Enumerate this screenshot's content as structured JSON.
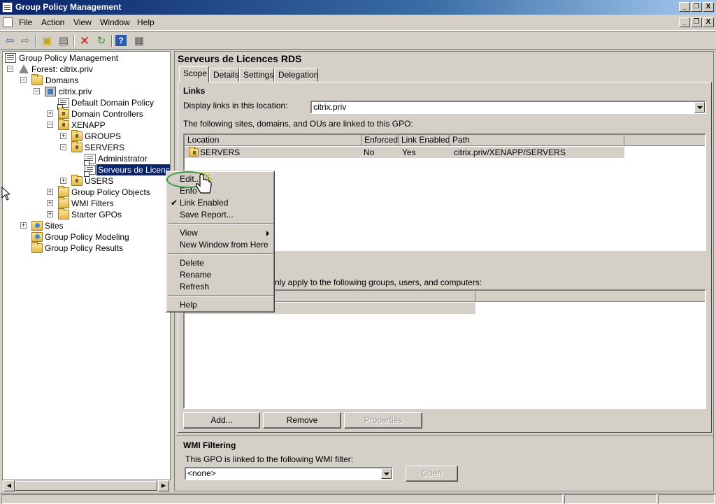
{
  "window": {
    "title": "Group Policy Management",
    "controls": {
      "minimize": "_",
      "restore": "❐",
      "close": "X"
    }
  },
  "menu": {
    "items": [
      "File",
      "Action",
      "View",
      "Window",
      "Help"
    ]
  },
  "toolbar": {
    "buttons": [
      "back-icon",
      "forward-icon",
      "up-folder-icon",
      "show-hide-tree-icon",
      "delete-icon",
      "refresh-icon",
      "help-icon",
      "properties-icon"
    ]
  },
  "tree": {
    "root": "Group Policy Management",
    "forest": "Forest: citrix.priv",
    "domains": "Domains",
    "domain": "citrix.priv",
    "default_domain_policy": "Default Domain Policy",
    "domain_controllers": "Domain Controllers",
    "xenapp": "XENAPP",
    "groups": "GROUPS",
    "servers": "SERVERS",
    "administrator": "Administrator",
    "serveurs_de_licences": "Serveurs de Licences",
    "users": "USERS",
    "group_policy_objects": "Group Policy Objects",
    "wmi_filters": "WMI Filters",
    "starter_gpos": "Starter GPOs",
    "sites": "Sites",
    "group_policy_modeling": "Group Policy Modeling",
    "group_policy_results": "Group Policy Results"
  },
  "gpo": {
    "title": "Serveurs de Licences RDS",
    "tabs": [
      "Scope",
      "Details",
      "Settings",
      "Delegation"
    ],
    "active_tab": "Scope",
    "links": {
      "header": "Links",
      "display_label": "Display links in this location:",
      "display_value": "citrix.priv",
      "list_caption": "The following sites, domains, and OUs are linked to this GPO:",
      "columns": [
        "Location",
        "Enforced",
        "Link Enabled",
        "Path"
      ],
      "rows": [
        {
          "location": "SERVERS",
          "enforced": "No",
          "link_enabled": "Yes",
          "path": "citrix.priv/XENAPP/SERVERS"
        }
      ]
    },
    "security_filtering": {
      "caption_partial": "nly apply to the following groups, users, and computers:"
    },
    "buttons": {
      "add": "Add...",
      "remove": "Remove",
      "properties": "Properties"
    },
    "wmi": {
      "header": "WMI Filtering",
      "caption": "This GPO is linked to the following WMI filter:",
      "value": "<none>",
      "open": "Open"
    }
  },
  "context_menu": {
    "edit": "Edit...",
    "enforced_partial": "Enfo",
    "link_enabled": "Link Enabled",
    "link_enabled_checked": true,
    "save_report": "Save Report...",
    "view": "View",
    "new_window": "New Window from Here",
    "delete": "Delete",
    "rename": "Rename",
    "refresh": "Refresh",
    "help": "Help"
  },
  "colors": {
    "titlebar_start": "#0a246a",
    "selection": "#0a246a",
    "highlight_oval": "#3c9a3c",
    "face": "#d4d0c8"
  }
}
